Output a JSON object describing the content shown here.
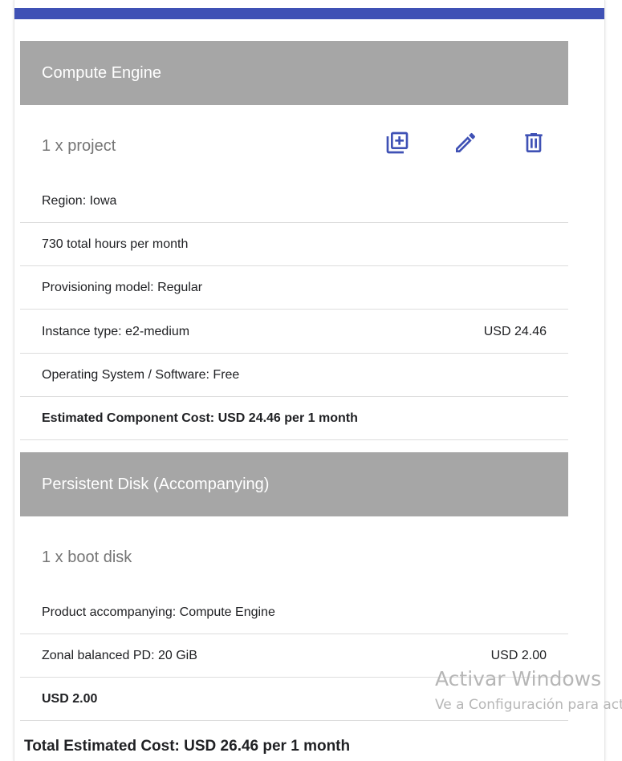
{
  "sections": [
    {
      "title": "Compute Engine",
      "item": "1 x project",
      "rows": [
        {
          "label": "Region: Iowa",
          "value": ""
        },
        {
          "label": "730 total hours per month",
          "value": ""
        },
        {
          "label": "Provisioning model: Regular",
          "value": ""
        },
        {
          "label": "Instance type: e2-medium",
          "value": "USD 24.46"
        },
        {
          "label": "Operating System / Software: Free",
          "value": ""
        }
      ],
      "summary": "Estimated Component Cost: USD 24.46 per 1 month"
    },
    {
      "title": "Persistent Disk (Accompanying)",
      "item": "1 x boot disk",
      "rows": [
        {
          "label": "Product accompanying: Compute Engine",
          "value": ""
        },
        {
          "label": "Zonal balanced PD: 20 GiB",
          "value": "USD 2.00"
        }
      ],
      "summary": "USD 2.00"
    }
  ],
  "actions": {
    "icons": [
      "duplicate-icon",
      "edit-icon",
      "delete-icon"
    ],
    "color": "#3f51b5"
  },
  "total": "Total Estimated Cost: USD 26.46 per 1 month",
  "watermark": {
    "line1": "Activar Windows",
    "line2": "Ve a Configuración para activar Windows."
  },
  "colors": {
    "accent": "#3f51b5",
    "section_header_bg": "#a6a6a6"
  }
}
